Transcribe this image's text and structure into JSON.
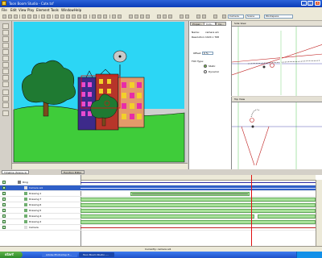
{
  "window": {
    "title": "Toon Boom Studio - Cate.tsf"
  },
  "menu": {
    "items": [
      "File",
      "Edit",
      "View",
      "Play",
      "Element",
      "Tools",
      "Window",
      "Help"
    ]
  },
  "toolbar": {
    "dropdown_camera": "Camera",
    "dropdown_scene": "Scene",
    "dropdown_workspace": "Workspace"
  },
  "properties": {
    "tabs": [
      "Proper...",
      "Colo...",
      "Ca..."
    ],
    "name_label": "Name:",
    "name_value": "camera ai1",
    "resolution_label": "Resolution:",
    "resolution_value": "1024 x 768",
    "offset_label": "Offset:",
    "offset_value": "0 %",
    "fov_label": "FOV Type:",
    "fov_static": "Static",
    "fov_dynamic": "Dynamic"
  },
  "side_view": {
    "title": "Side View"
  },
  "top_view": {
    "title": "Top View"
  },
  "timeline": {
    "tabs": [
      "Timeline (Scene-1)",
      "Function Editor"
    ],
    "layers": [
      "Ring",
      "Camera ai1",
      "Drawing 1",
      "Drawing 7",
      "Drawing 6",
      "Drawing 5",
      "Drawing 4",
      "Drawing 2",
      "Camera"
    ],
    "status": "Currently: camera ai1"
  },
  "taskbar": {
    "start": "start",
    "tasks": [
      "Adobe Photoshop E...",
      "Toon Boom Studio -..."
    ]
  },
  "colors": {
    "accent_blue": "#0a3cb8",
    "frames_green": "#a9e29a",
    "playhead": "#e01010"
  }
}
